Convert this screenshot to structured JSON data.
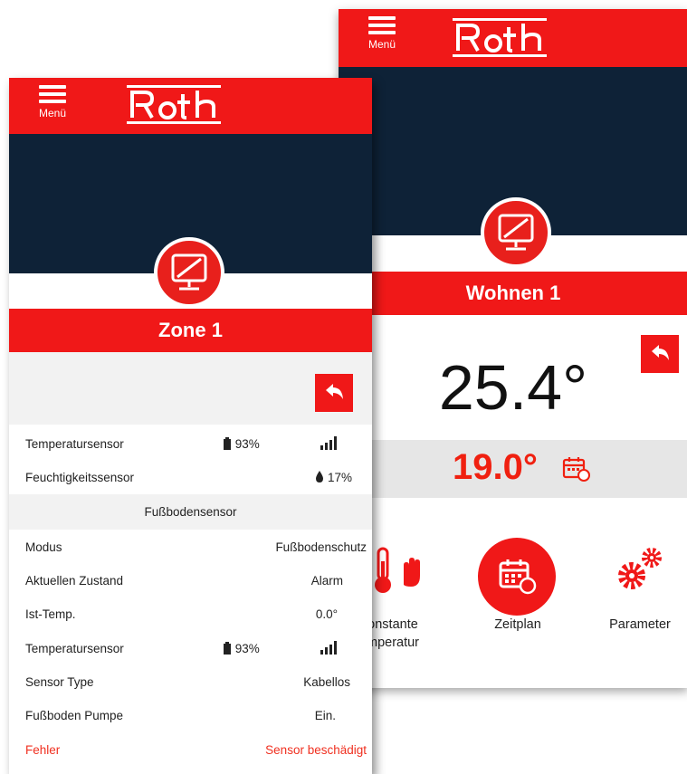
{
  "back_screen": {
    "menu_label": "Menü",
    "zone_name": "Wohnen 1",
    "current_temp": "25.4°",
    "setpoint": "19.0°",
    "actions": [
      {
        "label_line1": "onstante",
        "label_line2": "mperatur"
      },
      {
        "label_line1": "Zeitplan"
      },
      {
        "label_line1": "Parameter"
      }
    ]
  },
  "front_screen": {
    "menu_label": "Menü",
    "zone_name": "Zone 1",
    "sensor_rows": [
      {
        "label": "Temperatursensor",
        "battery": "93%"
      },
      {
        "label": "Feuchtigkeitssensor",
        "humidity": "17%"
      }
    ],
    "section_title": "Fußbodensensor",
    "floor_rows": [
      {
        "label": "Modus",
        "value": "Fußbodenschutz"
      },
      {
        "label": "Aktuellen Zustand",
        "value": "Alarm"
      },
      {
        "label": "Ist-Temp.",
        "value": "0.0°"
      },
      {
        "label": "Temperatursensor",
        "battery": "93%"
      },
      {
        "label": "Sensor Type",
        "value": "Kabellos"
      },
      {
        "label": "Fußboden Pumpe",
        "value": "Ein."
      },
      {
        "label": "Fehler",
        "value": "Sensor beschädigt"
      }
    ]
  },
  "brand": {
    "logo_text": "Roth",
    "accent": "#f01818",
    "navy": "#0e2237",
    "error_text": "#f03020"
  }
}
